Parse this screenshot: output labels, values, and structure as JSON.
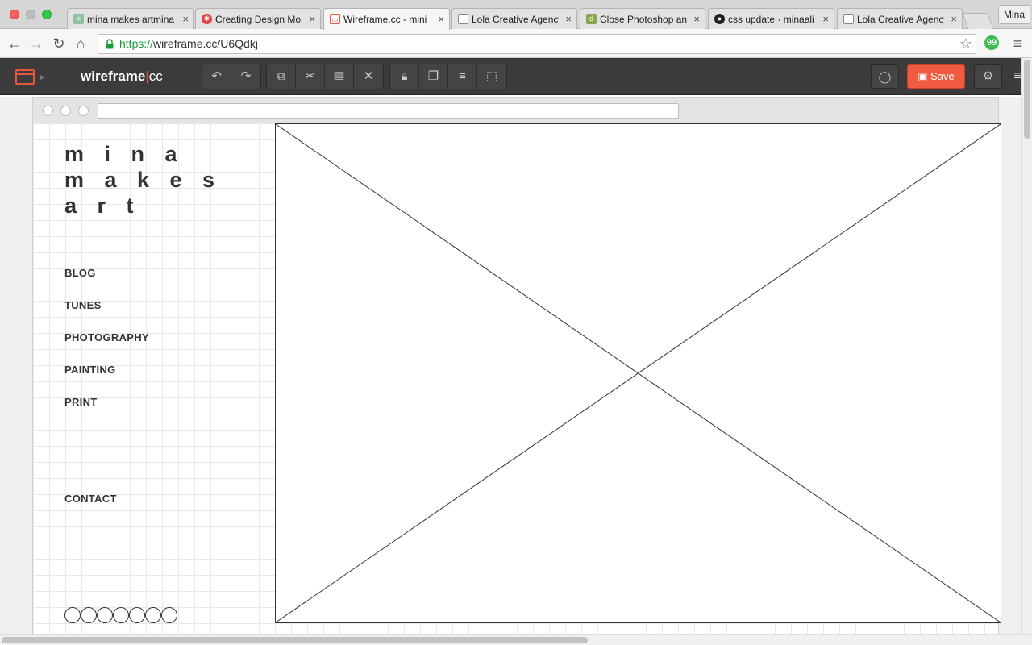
{
  "browser": {
    "tabs": [
      {
        "label": "mina makes artmina",
        "icon": "page-icon",
        "color": "#8fc0a0"
      },
      {
        "label": "Creating Design Mo",
        "icon": "logo-icon",
        "color": "#e0413f"
      },
      {
        "label": "Wireframe.cc - mini",
        "icon": "wireframe-icon",
        "color": "#e8563e"
      },
      {
        "label": "Lola Creative Agency",
        "icon": "document-icon",
        "color": "#777777"
      },
      {
        "label": "Close Photoshop an",
        "icon": "d-icon",
        "color": "#86a94f"
      },
      {
        "label": "css update · minaali",
        "icon": "github-icon",
        "color": "#222222"
      },
      {
        "label": "Lola Creative Agency",
        "icon": "document-icon",
        "color": "#777777"
      }
    ],
    "profile_name": "Mina",
    "url_protocol": "https://",
    "url_rest": "wireframe.cc/U6Qdkj"
  },
  "app": {
    "name": "wireframe",
    "name_divider": "|",
    "name_suffix": "cc",
    "save_label": "Save",
    "accent_color": "#f05a40"
  },
  "wireframe": {
    "title": "m i n a\nm a k e s\na r t",
    "nav": [
      "BLOG",
      "TUNES",
      "PHOTOGRAPHY",
      "PAINTING",
      "PRINT"
    ],
    "contact": "CONTACT",
    "social_circle_count": 7
  }
}
